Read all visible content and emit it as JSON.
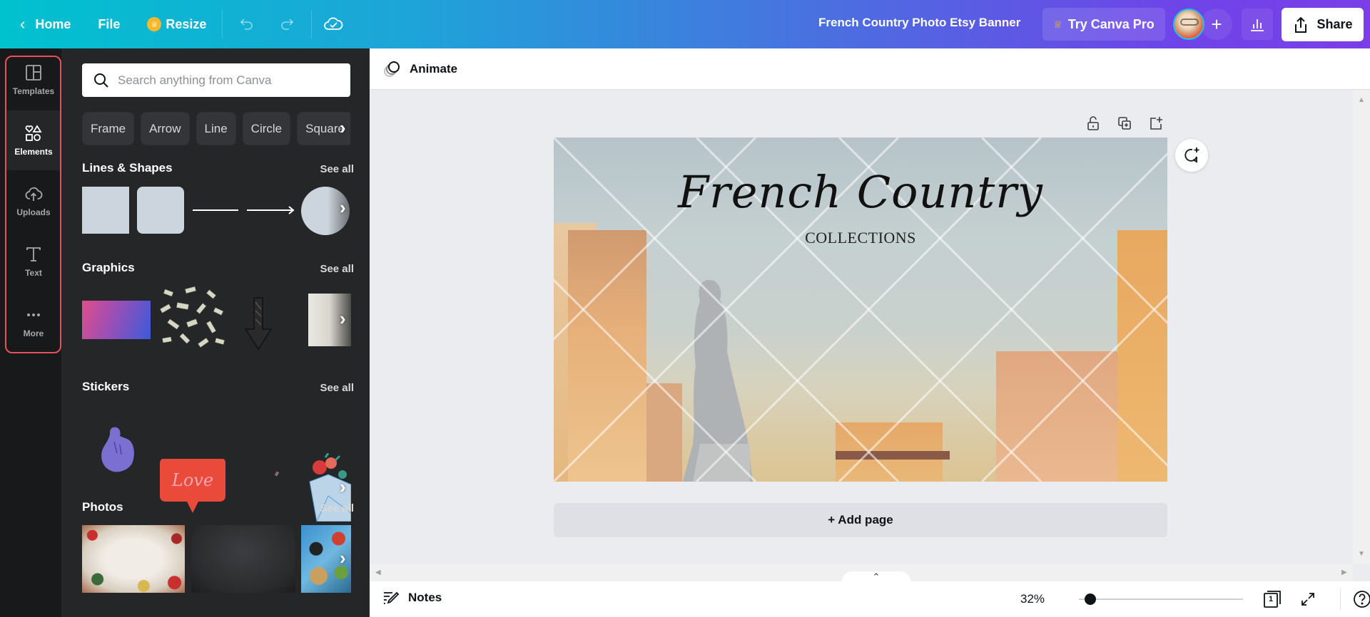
{
  "topbar": {
    "home_label": "Home",
    "file_label": "File",
    "resize_label": "Resize",
    "doc_title": "French Country Photo Etsy Banner",
    "try_pro_label": "Try Canva Pro",
    "share_label": "Share",
    "gradient_start": "#00c2cf",
    "gradient_end": "#7b3ee8"
  },
  "rail": {
    "items": [
      {
        "id": "templates",
        "label": "Templates",
        "icon": "templates-icon",
        "active": false
      },
      {
        "id": "elements",
        "label": "Elements",
        "icon": "elements-icon",
        "active": true
      },
      {
        "id": "uploads",
        "label": "Uploads",
        "icon": "upload-cloud-icon",
        "active": false
      },
      {
        "id": "text",
        "label": "Text",
        "icon": "text-icon",
        "active": false
      },
      {
        "id": "more",
        "label": "More",
        "icon": "more-dots-icon",
        "active": false
      }
    ],
    "highlight_color": "#e9505e"
  },
  "panel": {
    "search_placeholder": "Search anything from Canva",
    "search_value": "",
    "chips": [
      "Frame",
      "Arrow",
      "Line",
      "Circle",
      "Square"
    ],
    "sections": [
      {
        "title": "Lines & Shapes",
        "see_all": "See all",
        "items": [
          "square-shape",
          "rounded-square-shape",
          "line",
          "arrow-line",
          "circle-shape"
        ]
      },
      {
        "title": "Graphics",
        "see_all": "See all",
        "items": [
          "pink-blue-gradient",
          "flying-money",
          "sketched-down-arrow",
          "white-gradient"
        ]
      },
      {
        "title": "Stickers",
        "see_all": "See all",
        "items": [
          "purple-hand",
          "love-speech-bubble",
          "small-mark",
          "flower-envelope"
        ]
      },
      {
        "title": "Photos",
        "see_all": "See all",
        "items": [
          "christmas-frame-photo",
          "chalkboard-photo",
          "social-icons-photo"
        ]
      }
    ]
  },
  "canvas": {
    "animate_label": "Animate",
    "design_title": "French Country",
    "design_subtitle": "COLLECTIONS",
    "add_page_label": "+ Add page"
  },
  "footer": {
    "notes_label": "Notes",
    "zoom_percent": "32%",
    "zoom_value": 32,
    "page_count": "1"
  }
}
